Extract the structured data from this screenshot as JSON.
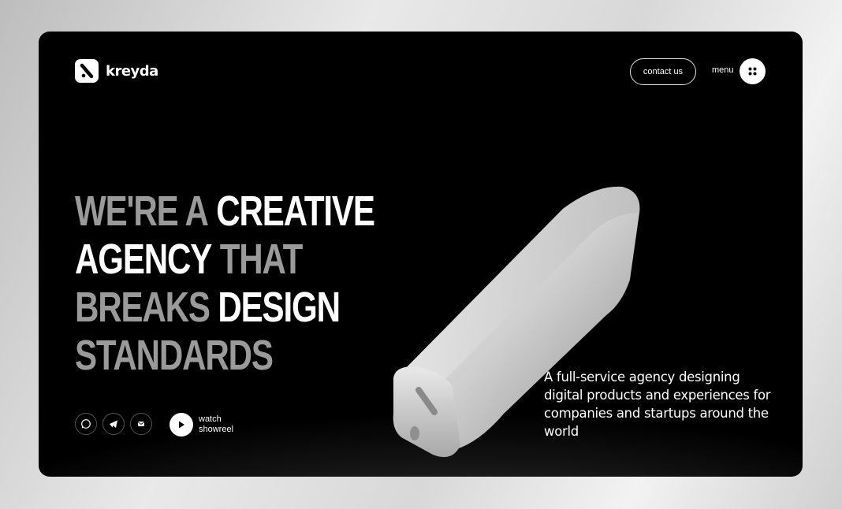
{
  "brand": {
    "name": "kreyda",
    "logo_icon": "slash-logo-icon"
  },
  "header": {
    "contact_label": "contact us",
    "menu_label": "menu",
    "menu_icon": "four-dots-icon"
  },
  "hero": {
    "headline_lines": [
      [
        {
          "text": "WE'RE A ",
          "tone": "gray"
        },
        {
          "text": "CREATIVE",
          "tone": "white"
        }
      ],
      [
        {
          "text": "AGENCY ",
          "tone": "white"
        },
        {
          "text": "THAT",
          "tone": "gray"
        }
      ],
      [
        {
          "text": "BREAKS ",
          "tone": "gray"
        },
        {
          "text": "DESIGN",
          "tone": "white"
        }
      ],
      [
        {
          "text": "STANDARDS",
          "tone": "gray"
        }
      ]
    ],
    "tagline": "A full-service  agency designing digital products and experiences for companies and startups around the world"
  },
  "social": [
    {
      "name": "whatsapp-icon"
    },
    {
      "name": "telegram-icon"
    },
    {
      "name": "mail-icon"
    }
  ],
  "showreel": {
    "line1": "watch",
    "line2": "showreel",
    "icon": "play-icon"
  },
  "colors": {
    "background": "#000000",
    "accent": "#ffffff",
    "muted_text": "#9a9a9a"
  }
}
